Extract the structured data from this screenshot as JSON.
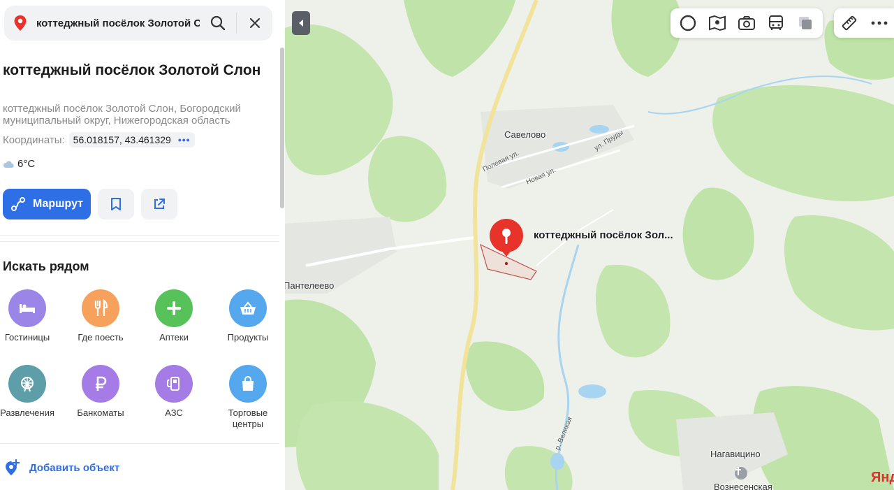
{
  "search": {
    "query": "коттеджный посёлок Золотой С"
  },
  "place": {
    "title": "коттеджный посёлок Золотой Слон",
    "address": "коттеджный посёлок Золотой Слон, Богородский муниципальный округ, Нижегородская область",
    "coords_label": "Координаты:",
    "coords_value": "56.018157, 43.461329",
    "coords_more": "•••",
    "temperature": "6°C"
  },
  "actions": {
    "route_label": "Маршрут"
  },
  "nearby": {
    "title": "Искать рядом",
    "categories": [
      {
        "label": "Гостиницы",
        "color": "#9b86e8",
        "icon": "bed-icon"
      },
      {
        "label": "Где поесть",
        "color": "#f6a15c",
        "icon": "fork-knife-icon"
      },
      {
        "label": "Аптеки",
        "color": "#58c25a",
        "icon": "plus-icon"
      },
      {
        "label": "Продукты",
        "color": "#56a8ee",
        "icon": "basket-icon"
      },
      {
        "label": "Развлечения",
        "color": "#5e9ea8",
        "icon": "ferris-wheel-icon"
      },
      {
        "label": "Банкоматы",
        "color": "#a57be6",
        "icon": "ruble-icon"
      },
      {
        "label": "АЗС",
        "color": "#a57be6",
        "icon": "fuel-icon"
      },
      {
        "label": "Торговые центры",
        "color": "#56a8ee",
        "icon": "shopping-bag-icon"
      }
    ]
  },
  "add_object": {
    "label": "Добавить объект"
  },
  "map": {
    "pin_label": "коттеджный посёлок Зол...",
    "villages": [
      "Савелово",
      "Пантелеево",
      "Нагавицино",
      "Вознесенская"
    ],
    "streets": [
      "Полевая ул.",
      "Новая ул.",
      "ул. Пруды"
    ],
    "river": "р. Великая",
    "brand": "Янд"
  },
  "colors": {
    "accent": "#2f6fe6",
    "pin": "#e8332b",
    "forest": "#bfe3a8",
    "water": "#a7d4f0",
    "road": "#f2e39a"
  }
}
